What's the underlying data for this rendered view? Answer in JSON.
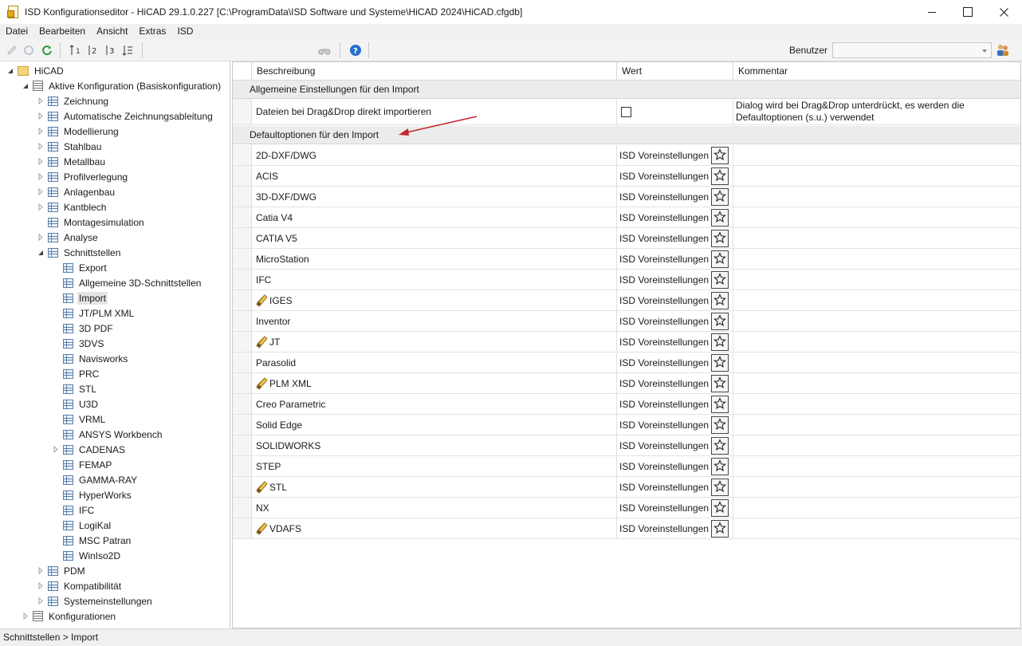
{
  "window": {
    "title": "ISD Konfigurationseditor  - HiCAD 29.1.0.227 [C:\\ProgramData\\ISD Software und Systeme\\HiCAD 2024\\HiCAD.cfgdb]"
  },
  "menu": [
    "Datei",
    "Bearbeiten",
    "Ansicht",
    "Extras",
    "ISD"
  ],
  "toolbar": {
    "benutzer_label": "Benutzer",
    "benutzer_value": ""
  },
  "tree": [
    {
      "label": "HiCAD",
      "icon": "folder",
      "expanded": true
    },
    {
      "label": "Aktive Konfiguration (Basiskonfiguration)",
      "icon": "list",
      "expanded": true
    },
    {
      "label": "Zeichnung",
      "icon": "grid",
      "collapsed": true
    },
    {
      "label": "Automatische Zeichnungsableitung",
      "icon": "grid",
      "collapsed": true
    },
    {
      "label": "Modellierung",
      "icon": "grid",
      "collapsed": true
    },
    {
      "label": "Stahlbau",
      "icon": "grid",
      "collapsed": true
    },
    {
      "label": "Metallbau",
      "icon": "grid",
      "collapsed": true
    },
    {
      "label": "Profilverlegung",
      "icon": "grid",
      "collapsed": true
    },
    {
      "label": "Anlagenbau",
      "icon": "grid",
      "collapsed": true
    },
    {
      "label": "Kantblech",
      "icon": "grid",
      "collapsed": true
    },
    {
      "label": "Montagesimulation",
      "icon": "grid"
    },
    {
      "label": "Analyse",
      "icon": "grid",
      "collapsed": true
    },
    {
      "label": "Schnittstellen",
      "icon": "grid",
      "expanded": true
    },
    {
      "label": "Export",
      "icon": "grid"
    },
    {
      "label": "Allgemeine 3D-Schnittstellen",
      "icon": "grid"
    },
    {
      "label": "Import",
      "icon": "grid",
      "selected": true
    },
    {
      "label": "JT/PLM XML",
      "icon": "grid"
    },
    {
      "label": "3D PDF",
      "icon": "grid"
    },
    {
      "label": "3DVS",
      "icon": "grid"
    },
    {
      "label": "Navisworks",
      "icon": "grid"
    },
    {
      "label": "PRC",
      "icon": "grid"
    },
    {
      "label": "STL",
      "icon": "grid"
    },
    {
      "label": "U3D",
      "icon": "grid"
    },
    {
      "label": "VRML",
      "icon": "grid"
    },
    {
      "label": "ANSYS Workbench",
      "icon": "grid"
    },
    {
      "label": "CADENAS",
      "icon": "grid",
      "collapsed": true
    },
    {
      "label": "FEMAP",
      "icon": "grid"
    },
    {
      "label": "GAMMA-RAY",
      "icon": "grid"
    },
    {
      "label": "HyperWorks",
      "icon": "grid"
    },
    {
      "label": "IFC",
      "icon": "grid"
    },
    {
      "label": "LogiKal",
      "icon": "grid"
    },
    {
      "label": "MSC Patran",
      "icon": "grid"
    },
    {
      "label": "WinIso2D",
      "icon": "grid"
    },
    {
      "label": "PDM",
      "icon": "grid",
      "collapsed": true
    },
    {
      "label": "Kompatibilität",
      "icon": "grid",
      "collapsed": true
    },
    {
      "label": "Systemeinstellungen",
      "icon": "grid",
      "collapsed": true
    },
    {
      "label": "Konfigurationen",
      "icon": "list",
      "collapsed": true
    }
  ],
  "grid": {
    "columns": [
      "Beschreibung",
      "Wert",
      "Kommentar"
    ],
    "group1": {
      "title": "Allgemeine Einstellungen für den Import",
      "rows": [
        {
          "desc": "Dateien bei Drag&Drop direkt importieren",
          "value": "",
          "checked": false,
          "comment": "Dialog wird bei Drag&Drop unterdrückt, es werden die Defaultoptionen (s.u.) verwendet"
        }
      ]
    },
    "group2": {
      "title": "Defaultoptionen für den Import",
      "rows": [
        {
          "desc": "2D-DXF/DWG",
          "value": "ISD Voreinstellungen",
          "modified": false
        },
        {
          "desc": "ACIS",
          "value": "ISD Voreinstellungen",
          "modified": false
        },
        {
          "desc": "3D-DXF/DWG",
          "value": "ISD Voreinstellungen",
          "modified": false
        },
        {
          "desc": "Catia V4",
          "value": "ISD Voreinstellungen",
          "modified": false
        },
        {
          "desc": "CATIA V5",
          "value": "ISD Voreinstellungen",
          "modified": false
        },
        {
          "desc": "MicroStation",
          "value": "ISD Voreinstellungen",
          "modified": false
        },
        {
          "desc": "IFC",
          "value": "ISD Voreinstellungen",
          "modified": false
        },
        {
          "desc": "IGES",
          "value": "ISD Voreinstellungen",
          "modified": true
        },
        {
          "desc": "Inventor",
          "value": "ISD Voreinstellungen",
          "modified": false
        },
        {
          "desc": "JT",
          "value": "ISD Voreinstellungen",
          "modified": true
        },
        {
          "desc": "Parasolid",
          "value": "ISD Voreinstellungen",
          "modified": false
        },
        {
          "desc": "PLM XML",
          "value": "ISD Voreinstellungen",
          "modified": true
        },
        {
          "desc": "Creo Parametric",
          "value": "ISD Voreinstellungen",
          "modified": false
        },
        {
          "desc": "Solid Edge",
          "value": "ISD Voreinstellungen",
          "modified": false
        },
        {
          "desc": "SOLIDWORKS",
          "value": "ISD Voreinstellungen",
          "modified": false
        },
        {
          "desc": "STEP",
          "value": "ISD Voreinstellungen",
          "modified": false
        },
        {
          "desc": "STL",
          "value": "ISD Voreinstellungen",
          "modified": true
        },
        {
          "desc": "NX",
          "value": "ISD Voreinstellungen",
          "modified": false
        },
        {
          "desc": "VDAFS",
          "value": "ISD Voreinstellungen",
          "modified": true
        }
      ]
    }
  },
  "status": {
    "breadcrumb": "Schnittstellen > Import"
  },
  "colors": {
    "annotation_arrow": "#c0282d",
    "group_header_bg": "#ececec",
    "selection_bg": "#e5e5e5"
  }
}
